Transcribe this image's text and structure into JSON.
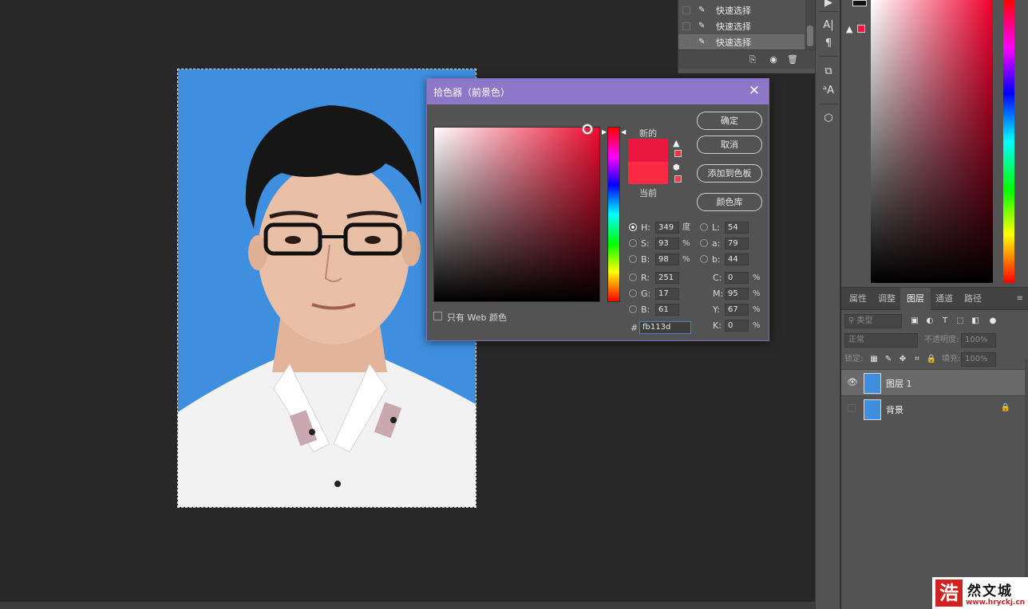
{
  "history": {
    "items": [
      {
        "label": "快速选择",
        "selected": false
      },
      {
        "label": "快速选择",
        "selected": false
      },
      {
        "label": "快速选择",
        "selected": true
      }
    ]
  },
  "color_picker": {
    "title": "拾色器（前景色）",
    "new_label": "新的",
    "current_label": "当前",
    "buttons": {
      "ok": "确定",
      "cancel": "取消",
      "add_to_swatches": "添加到色板",
      "color_libraries": "颜色库"
    },
    "hsb": {
      "h": {
        "label": "H:",
        "value": "349",
        "unit": "度"
      },
      "s": {
        "label": "S:",
        "value": "93",
        "unit": "%"
      },
      "b": {
        "label": "B:",
        "value": "98",
        "unit": "%"
      }
    },
    "lab": {
      "l": {
        "label": "L:",
        "value": "54"
      },
      "a": {
        "label": "a:",
        "value": "79"
      },
      "b": {
        "label": "b:",
        "value": "44"
      }
    },
    "rgb": {
      "r": {
        "label": "R:",
        "value": "251"
      },
      "g": {
        "label": "G:",
        "value": "17"
      },
      "b": {
        "label": "B:",
        "value": "61"
      }
    },
    "cmyk": {
      "c": {
        "label": "C:",
        "value": "0",
        "unit": "%"
      },
      "m": {
        "label": "M:",
        "value": "95",
        "unit": "%"
      },
      "y": {
        "label": "Y:",
        "value": "67",
        "unit": "%"
      },
      "k": {
        "label": "K:",
        "value": "0",
        "unit": "%"
      }
    },
    "hex_label": "#",
    "hex": "fb113d",
    "web_only_label": "只有 Web 颜色",
    "selected_color": "#fb113d"
  },
  "layers_panel": {
    "tabs": [
      "属性",
      "调整",
      "图层",
      "通道",
      "路径"
    ],
    "active_tab": "图层",
    "filter_placeholder": "类型",
    "blend_mode": "正常",
    "opacity_label": "不透明度:",
    "opacity_value": "100%",
    "lock_label": "锁定:",
    "fill_label": "填充:",
    "fill_value": "100%",
    "layers": [
      {
        "name": "图层 1",
        "selected": true,
        "visible": true
      },
      {
        "name": "背景",
        "selected": false,
        "visible": false,
        "locked": true
      }
    ]
  },
  "watermark": {
    "logo_char": "浩",
    "brand": "然文城",
    "url": "www.hryckj.cn"
  },
  "icons": {
    "toolstrip": [
      "play-icon",
      "character-icon",
      "paragraph-icon",
      "clone-source-icon",
      "glyphs-icon",
      "3d-icon"
    ],
    "history_footer": [
      "new-document-from-state-icon",
      "snapshot-icon",
      "trash-icon"
    ]
  }
}
